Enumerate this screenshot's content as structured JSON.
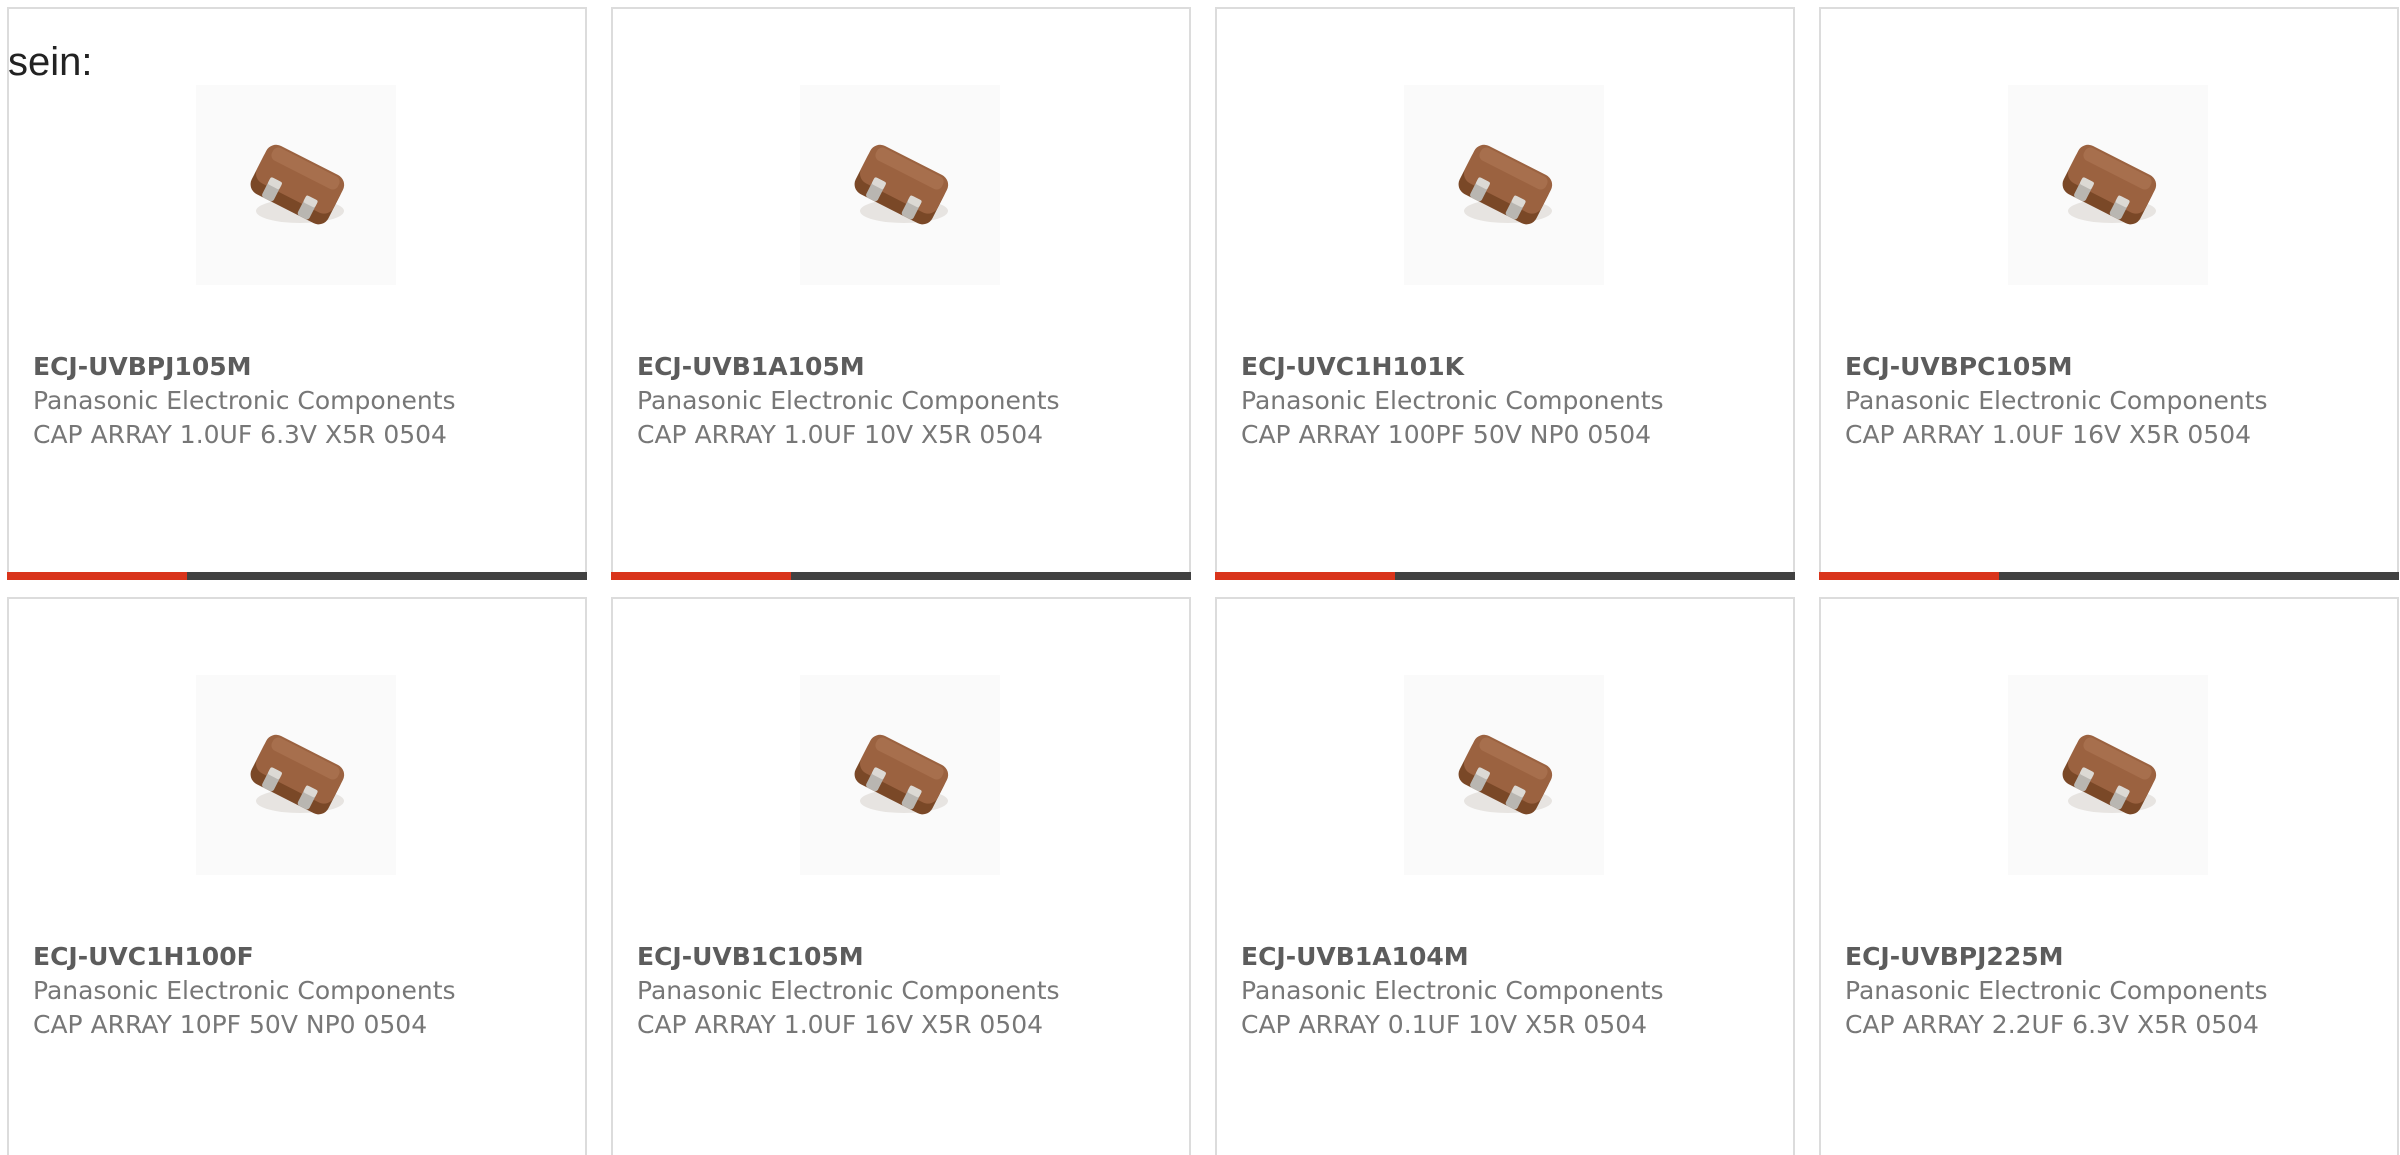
{
  "intro_text": "sein:",
  "colors": {
    "accent": "#d9341b",
    "bar_track": "#414141",
    "card_border": "#dcdcdc",
    "part_number": "#5c5c5c",
    "secondary_text": "#777777"
  },
  "products": [
    {
      "part_number": "ECJ-UVBPJ105M",
      "manufacturer": "Panasonic Electronic Components",
      "description": "CAP ARRAY 1.0UF 6.3V X5R 0504",
      "image_icon": "capacitor-array-chip-icon",
      "progress": 0.31
    },
    {
      "part_number": "ECJ-UVB1A105M",
      "manufacturer": "Panasonic Electronic Components",
      "description": "CAP ARRAY 1.0UF 10V X5R 0504",
      "image_icon": "capacitor-array-chip-icon",
      "progress": 0.31
    },
    {
      "part_number": "ECJ-UVC1H101K",
      "manufacturer": "Panasonic Electronic Components",
      "description": "CAP ARRAY 100PF 50V NP0 0504",
      "image_icon": "capacitor-array-chip-icon",
      "progress": 0.31
    },
    {
      "part_number": "ECJ-UVBPC105M",
      "manufacturer": "Panasonic Electronic Components",
      "description": "CAP ARRAY 1.0UF 16V X5R 0504",
      "image_icon": "capacitor-array-chip-icon",
      "progress": 0.31
    },
    {
      "part_number": "ECJ-UVC1H100F",
      "manufacturer": "Panasonic Electronic Components",
      "description": "CAP ARRAY 10PF 50V NP0 0504",
      "image_icon": "capacitor-array-chip-icon",
      "progress": 0.31
    },
    {
      "part_number": "ECJ-UVB1C105M",
      "manufacturer": "Panasonic Electronic Components",
      "description": "CAP ARRAY 1.0UF 16V X5R 0504",
      "image_icon": "capacitor-array-chip-icon",
      "progress": 0.31
    },
    {
      "part_number": "ECJ-UVB1A104M",
      "manufacturer": "Panasonic Electronic Components",
      "description": "CAP ARRAY 0.1UF 10V X5R 0504",
      "image_icon": "capacitor-array-chip-icon",
      "progress": 0.31
    },
    {
      "part_number": "ECJ-UVBPJ225M",
      "manufacturer": "Panasonic Electronic Components",
      "description": "CAP ARRAY 2.2UF 6.3V X5R 0504",
      "image_icon": "capacitor-array-chip-icon",
      "progress": 0.31
    }
  ]
}
